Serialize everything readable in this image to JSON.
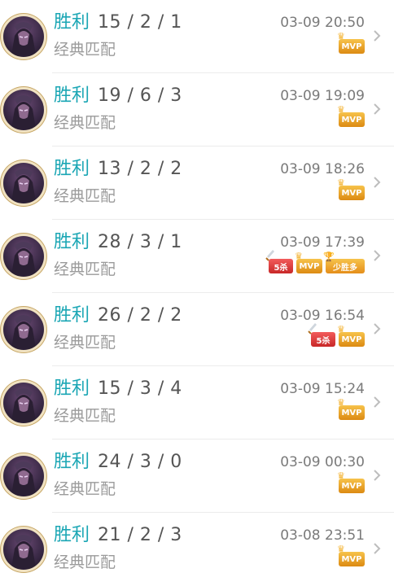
{
  "matches": [
    {
      "result": "胜利",
      "kda": "15 / 2 / 1",
      "mode": "经典匹配",
      "time": "03-09 20:50",
      "badges": [
        "MVP"
      ]
    },
    {
      "result": "胜利",
      "kda": "19 / 6 / 3",
      "mode": "经典匹配",
      "time": "03-09 19:09",
      "badges": [
        "MVP"
      ]
    },
    {
      "result": "胜利",
      "kda": "13 / 2 / 2",
      "mode": "经典匹配",
      "time": "03-09 18:26",
      "badges": [
        "MVP"
      ]
    },
    {
      "result": "胜利",
      "kda": "28 / 3 / 1",
      "mode": "经典匹配",
      "time": "03-09 17:39",
      "badges": [
        "5杀",
        "MVP",
        "少胜多"
      ]
    },
    {
      "result": "胜利",
      "kda": "26 / 2 / 2",
      "mode": "经典匹配",
      "time": "03-09 16:54",
      "badges": [
        "5杀",
        "MVP"
      ]
    },
    {
      "result": "胜利",
      "kda": "15 / 3 / 4",
      "mode": "经典匹配",
      "time": "03-09 15:24",
      "badges": [
        "MVP"
      ]
    },
    {
      "result": "胜利",
      "kda": "24 / 3 / 0",
      "mode": "经典匹配",
      "time": "03-09 00:30",
      "badges": [
        "MVP"
      ]
    },
    {
      "result": "胜利",
      "kda": "21 / 2 / 3",
      "mode": "经典匹配",
      "time": "03-08 23:51",
      "badges": [
        "MVP"
      ]
    }
  ],
  "colors": {
    "win": "#1aa6b4",
    "mvp": "#f2a623",
    "kill": "#e23b3b"
  }
}
